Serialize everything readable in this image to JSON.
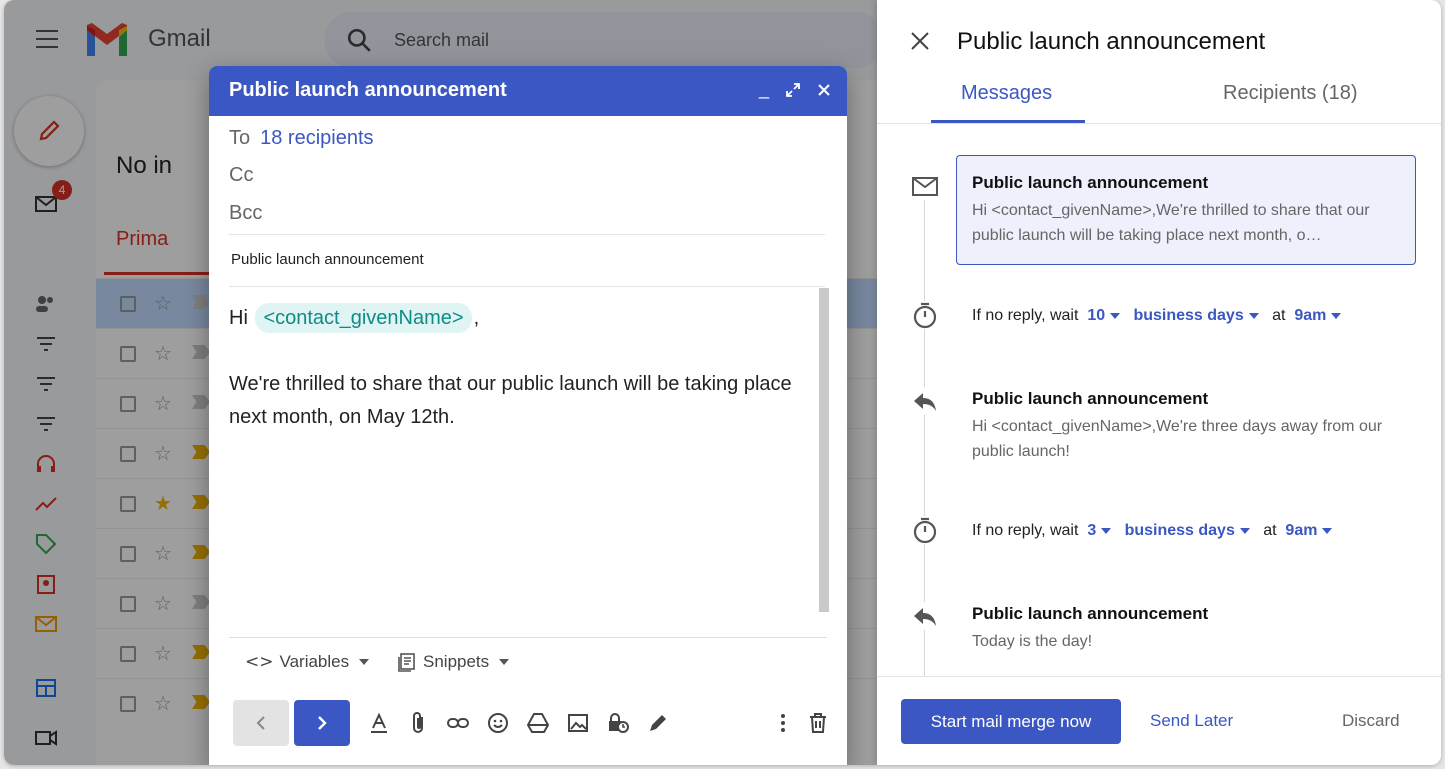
{
  "gmail": {
    "app_name": "Gmail",
    "search_placeholder": "Search mail",
    "inbox_heading": "No in",
    "primary_tab": "Prima",
    "unread_badge": "4"
  },
  "compose": {
    "title": "Public launch announcement",
    "to_label": "To",
    "to_value": "18 recipients",
    "cc_label": "Cc",
    "bcc_label": "Bcc",
    "subject": "Public launch announcement",
    "body_greeting": "Hi",
    "body_variable": "<contact_givenName>",
    "body_comma": ",",
    "body_text": "We're thrilled to share that our public launch will be taking place next month, on May 12th.",
    "variables_menu": "Variables",
    "snippets_menu": "Snippets"
  },
  "panel": {
    "title": "Public launch announcement",
    "tabs": [
      {
        "label": "Messages"
      },
      {
        "label": "Recipients (18)"
      }
    ],
    "steps": [
      {
        "title": "Public launch announcement",
        "preview": "Hi <contact_givenName>,We're thrilled to share that our public launch will be taking place next month, o…"
      },
      {
        "title": "Public launch announcement",
        "preview": "Hi <contact_givenName>,We're three days away from our public launch!"
      },
      {
        "title": "Public launch announcement",
        "preview": "Today is the day!"
      }
    ],
    "waits": [
      {
        "prefix": "If no reply, wait",
        "count": "10",
        "unit": "business days",
        "at": "at",
        "time": "9am"
      },
      {
        "prefix": "If no reply, wait",
        "count": "3",
        "unit": "business days",
        "at": "at",
        "time": "9am"
      }
    ],
    "start_button": "Start mail merge now",
    "later_button": "Send Later",
    "discard_button": "Discard"
  },
  "colors": {
    "accent": "#3b57c4",
    "variable_chip": "#0f8b86",
    "gmail_red": "#d93025"
  }
}
